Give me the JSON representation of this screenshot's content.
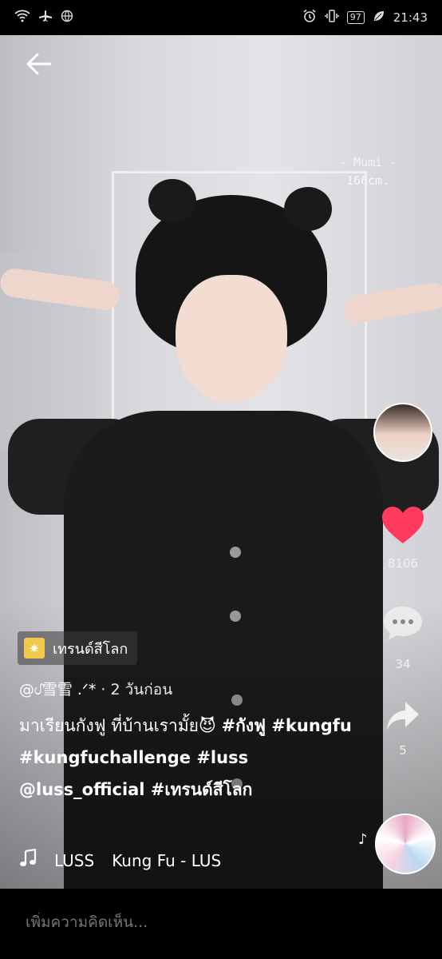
{
  "status_bar": {
    "battery": "97",
    "time": "21:43"
  },
  "video": {
    "watermark_line1": "- Mumi -",
    "watermark_line2": "166cm."
  },
  "actions": {
    "likes": "8106",
    "comments": "34",
    "shares": "5",
    "like_color": "#fe2c55"
  },
  "trend_badge": {
    "label": "เทรนด์สีโลก"
  },
  "post": {
    "author": "@ᦔ雪雪 .ᐟ*",
    "time_ago": " · 2 วันก่อน",
    "caption_text": "มาเรียนกังฟู ที่บ้านเรามั้ย😈 ",
    "caption_tags": "#กังฟู #kungfu #kungfuchallenge #luss @luss_official #เทรนด์สีโลก"
  },
  "music": {
    "artist": "LUSS",
    "title": "Kung Fu - LUS"
  },
  "comment": {
    "placeholder": "เพิ่มความคิดเห็น..."
  }
}
